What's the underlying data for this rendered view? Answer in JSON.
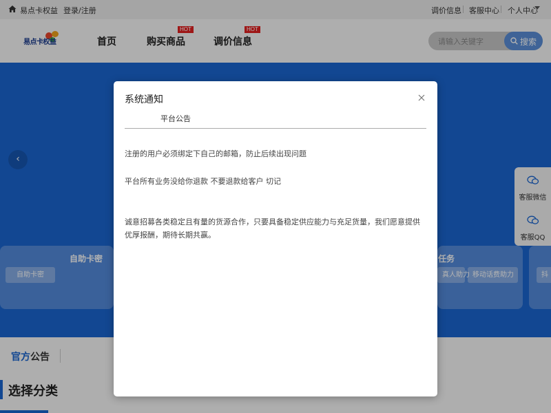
{
  "topbar": {
    "site_name": "易点卡权益",
    "login_register": "登录/注册",
    "links": [
      "调价信息",
      "客服中心",
      "个人中心"
    ]
  },
  "header": {
    "logo_text": "易点卡权益",
    "nav": [
      {
        "label": "首页",
        "badge": ""
      },
      {
        "label": "购买商品",
        "badge": "HOT"
      },
      {
        "label": "调价信息",
        "badge": "HOT"
      }
    ],
    "search_placeholder": "请输入关键字",
    "search_button": "搜索"
  },
  "banner": {
    "cards": [
      {
        "title": "自助卡密",
        "chips": [
          "自助卡密"
        ]
      },
      {
        "title": "任务",
        "chips": [
          "真人助力",
          "移动话费助力"
        ]
      },
      {
        "title": "",
        "chips": [
          "抖"
        ]
      }
    ]
  },
  "side_float": {
    "items": [
      "客服微信",
      "客服QQ"
    ]
  },
  "announcement": {
    "title_accent": "官方",
    "title_rest": "公告"
  },
  "category": {
    "title": "选择分类"
  },
  "modal": {
    "title": "系统通知",
    "tab": "平台公告",
    "lines": [
      "注册的用户必须绑定下自己的邮箱，防止后续出现问题",
      "平台所有业务没给你退款 不要退款给客户 切记",
      "诚意招募各类稳定且有量的货源合作，只要具备稳定供应能力与充足货量，我们愿意提供优厚报酬，期待长期共赢。"
    ]
  },
  "colors": {
    "brand_blue": "#1a66d2",
    "hot_red": "#e32222",
    "search_button": "#5b8fd8"
  }
}
